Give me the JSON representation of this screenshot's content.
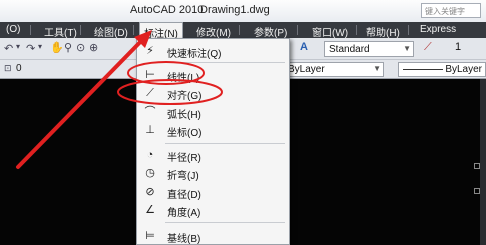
{
  "title_bar": {
    "app_name": "AutoCAD 2010",
    "document_name": "Drawing1.dwg",
    "search_placeholder": "键入关键字"
  },
  "menu_bar": {
    "items": [
      {
        "label": "(O)"
      },
      {
        "label": "工具(T)"
      },
      {
        "label": "绘图(D)"
      },
      {
        "label": "标注(N)",
        "active": true
      },
      {
        "label": "修改(M)"
      },
      {
        "label": "参数(P)"
      },
      {
        "label": "窗口(W)"
      },
      {
        "label": "帮助(H)"
      },
      {
        "label": "Express"
      }
    ]
  },
  "toolbar": {
    "text_style": "Standard",
    "number_value": "1",
    "layer_value": "0",
    "linetype_value": "ByLayer",
    "lineweight_value": "ByLayer"
  },
  "dimension_menu": {
    "items": [
      {
        "label": "快速标注(Q)",
        "icon": "quick-dimension-icon"
      },
      {
        "label": "线性(L)",
        "icon": "linear-dimension-icon"
      },
      {
        "label": "对齐(G)",
        "icon": "aligned-dimension-icon"
      },
      {
        "label": "弧长(H)",
        "icon": "arc-length-icon"
      },
      {
        "label": "坐标(O)",
        "icon": "ordinate-icon"
      },
      {
        "label": "半径(R)",
        "icon": "radius-icon"
      },
      {
        "label": "折弯(J)",
        "icon": "jogged-icon"
      },
      {
        "label": "直径(D)",
        "icon": "diameter-icon"
      },
      {
        "label": "角度(A)",
        "icon": "angular-icon"
      },
      {
        "label": "基线(B)",
        "icon": "baseline-icon"
      }
    ]
  },
  "colors": {
    "menubar_bg": "#36393f",
    "drawing_bg": "#050505",
    "annotation_red": "#e02020"
  }
}
